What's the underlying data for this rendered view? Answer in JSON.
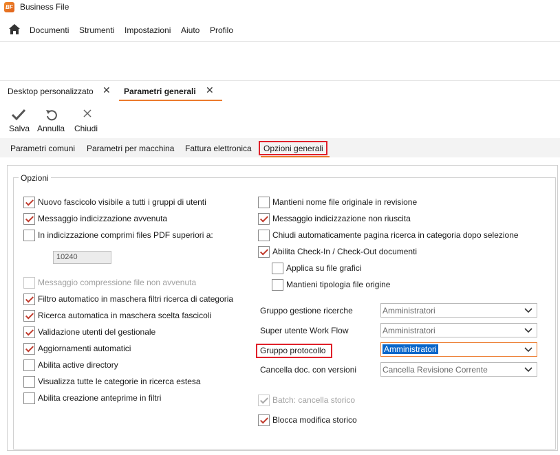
{
  "app": {
    "logo_text": "BF",
    "title": "Business File"
  },
  "menu": [
    "Documenti",
    "Strumenti",
    "Impostazioni",
    "Aiuto",
    "Profilo"
  ],
  "doc_tabs": [
    {
      "label": "Desktop personalizzato",
      "close": "✕",
      "active": false
    },
    {
      "label": "Parametri generali",
      "close": "✕",
      "active": true
    }
  ],
  "toolbar": {
    "save": "Salva",
    "undo": "Annulla",
    "close": "Chiudi"
  },
  "sub_tabs": [
    "Parametri comuni",
    "Parametri per macchina",
    "Fattura elettronica",
    "Opzioni generali"
  ],
  "active_sub_tab": "Opzioni generali",
  "group_title": "Opzioni",
  "left_options": [
    {
      "label": "Nuovo fascicolo visibile a tutti i gruppi di utenti",
      "checked": true,
      "disabled": false
    },
    {
      "label": "Messaggio indicizzazione avvenuta",
      "checked": true,
      "disabled": false
    },
    {
      "label": "In indicizzazione comprimi files PDF superiori a:",
      "checked": false,
      "disabled": false
    },
    {
      "label": "Messaggio compressione file non avvenuta",
      "checked": false,
      "disabled": true
    },
    {
      "label": "Filtro automatico in maschera filtri ricerca di categoria",
      "checked": true,
      "disabled": false
    },
    {
      "label": "Ricerca automatica in maschera scelta fascicoli",
      "checked": true,
      "disabled": false
    },
    {
      "label": "Validazione utenti del gestionale",
      "checked": true,
      "disabled": false
    },
    {
      "label": "Aggiornamenti automatici",
      "checked": true,
      "disabled": false
    },
    {
      "label": "Abilita active directory",
      "checked": false,
      "disabled": false
    },
    {
      "label": "Visualizza tutte le categorie in ricerca estesa",
      "checked": false,
      "disabled": false
    },
    {
      "label": "Abilita creazione anteprime in filtri",
      "checked": false,
      "disabled": false
    }
  ],
  "pdf_size_value": "10240",
  "right_options": [
    {
      "label": "Mantieni nome file originale in revisione",
      "checked": false,
      "disabled": false
    },
    {
      "label": "Messaggio indicizzazione non riuscita",
      "checked": true,
      "disabled": false
    },
    {
      "label": "Chiudi automaticamente pagina ricerca in categoria dopo selezione",
      "checked": false,
      "disabled": false
    },
    {
      "label": "Abilita Check-In / Check-Out documenti",
      "checked": true,
      "disabled": false
    },
    {
      "label": "Applica su file grafici",
      "checked": false,
      "disabled": false
    },
    {
      "label": "Mantieni tipologia file origine",
      "checked": false,
      "disabled": false
    }
  ],
  "combos": [
    {
      "label": "Gruppo gestione ricerche",
      "value": "Amministratori"
    },
    {
      "label": "Super utente Work Flow",
      "value": "Amministratori"
    },
    {
      "label": "Gruppo protocollo",
      "value": "Amministratori"
    },
    {
      "label": "Cancella doc. con versioni",
      "value": "Cancella Revisione Corrente"
    }
  ],
  "bottom_options": [
    {
      "label": "Batch: cancella storico",
      "checked": true,
      "disabled": true
    },
    {
      "label": "Blocca modifica storico",
      "checked": true,
      "disabled": false
    }
  ],
  "colors": {
    "accent": "#ec7a2c",
    "highlight_box": "#e0202a",
    "selection": "#0a66c9",
    "check": "#c0392b"
  }
}
